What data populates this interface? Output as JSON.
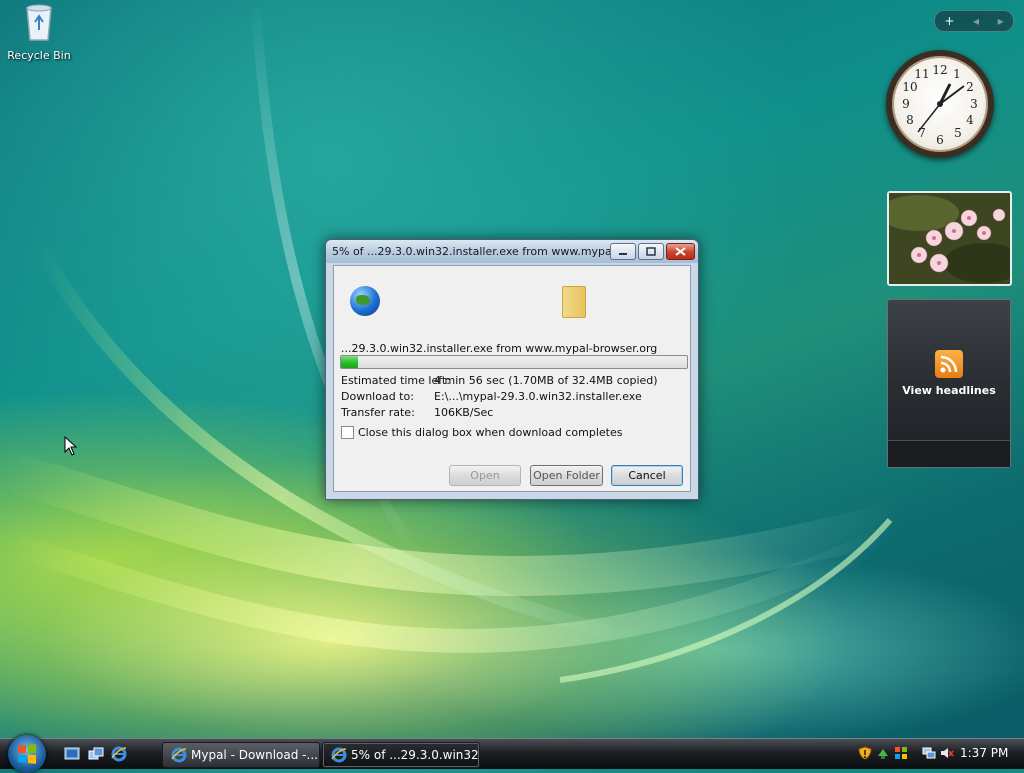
{
  "desktop": {
    "recycle_bin_label": "Recycle Bin"
  },
  "sidebar": {
    "controls": [
      "+",
      "◂",
      "▸"
    ],
    "feeds_label": "View headlines"
  },
  "dialog": {
    "title": "5% of ...29.3.0.win32.installer.exe from www.mypa...",
    "file_source": "...29.3.0.win32.installer.exe from www.mypal-browser.org",
    "progress": 0.05,
    "time_left_label": "Estimated time left:",
    "time_left_value": "4 min 56 sec (1.70MB of 32.4MB copied)",
    "download_to_label": "Download to:",
    "download_to_value": "E:\\...\\mypal-29.3.0.win32.installer.exe",
    "rate_label": "Transfer rate:",
    "rate_value": "106KB/Sec",
    "close_checkbox_label": "Close this dialog box when download completes",
    "open_button": "Open",
    "open_folder_button": "Open Folder",
    "cancel_button": "Cancel"
  },
  "taskbar": {
    "tasks": [
      {
        "label": "Mypal - Download -..."
      },
      {
        "label": "5% of ...29.3.0.win32..."
      }
    ],
    "time": "1:37 PM"
  }
}
